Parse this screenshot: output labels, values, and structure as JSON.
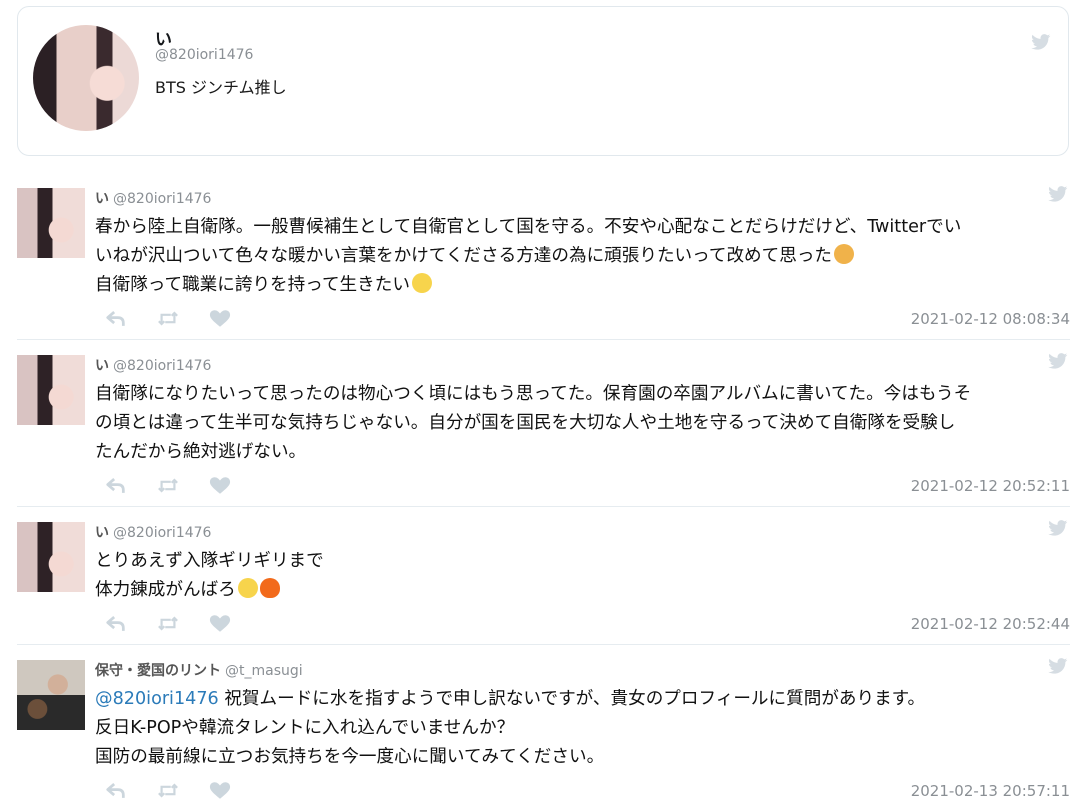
{
  "profile": {
    "name": "い",
    "handle": "@820iori1476",
    "bio": "BTS ジンチム推し"
  },
  "tweets": [
    {
      "name": "い",
      "handle": "@820iori1476",
      "lines": [
        "春から陸上自衛隊。一般曹候補生として自衛官として国を守る。不安や心配なことだらけだけど、Twitterでい",
        "いねが沢山ついて色々な暖かい言葉をかけてくださる方達の為に頑張りたいって改めて思った",
        "自衛隊って職業に誇りを持って生きたい"
      ],
      "timestamp": "2021-02-12 08:08:34"
    },
    {
      "name": "い",
      "handle": "@820iori1476",
      "lines": [
        "自衛隊になりたいって思ったのは物心つく頃にはもう思ってた。保育園の卒園アルバムに書いてた。今はもうそ",
        "の頃とは違って生半可な気持ちじゃない。自分が国を国民を大切な人や土地を守るって決めて自衛隊を受験し",
        "たんだから絶対逃げない。"
      ],
      "timestamp": "2021-02-12 20:52:11"
    },
    {
      "name": "い",
      "handle": "@820iori1476",
      "lines": [
        "とりあえず入隊ギリギリまで",
        "体力錬成がんばろ"
      ],
      "timestamp": "2021-02-12 20:52:44"
    },
    {
      "name": "保守・愛国のリント",
      "handle": "@t_masugi",
      "mention": "@820iori1476",
      "lines": [
        " 祝賀ムードに水を指すようで申し訳ないですが、貴女のプロフィールに質問があります。",
        "反日K-POPや韓流タレントに入れ込んでいませんか？",
        "国防の最前線に立つお気持ちを今一度心に聞いてみてください。"
      ],
      "timestamp": "2021-02-13 20:57:11"
    }
  ],
  "icons": [
    "twitter-bird-icon",
    "reply-icon",
    "retweet-icon",
    "like-icon"
  ],
  "colors": {
    "mention": "#2b7bb9",
    "muted": "#8a8f94",
    "border": "#e1e8ed",
    "action": "#ccd6dd"
  }
}
